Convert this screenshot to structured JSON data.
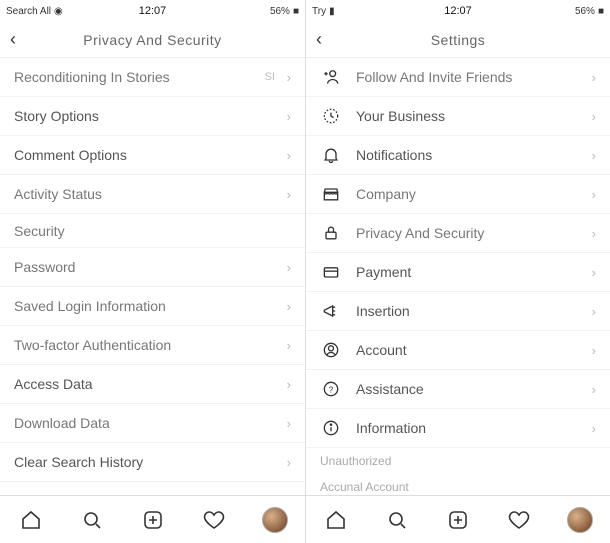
{
  "left": {
    "status": {
      "left": "Search All",
      "time": "12:07",
      "right": "56%"
    },
    "title": "Privacy And Security",
    "rows": [
      {
        "label": "Reconditioning In Stories",
        "mini": "SI",
        "chev": true,
        "strong": false
      },
      {
        "label": "Story Options",
        "chev": true,
        "strong": true
      },
      {
        "label": "Comment Options",
        "chev": true,
        "strong": true
      },
      {
        "label": "Activity Status",
        "chev": true
      },
      {
        "label": "Security",
        "section": true
      },
      {
        "label": "Password",
        "chev": true
      },
      {
        "label": "Saved Login Information",
        "chev": true
      },
      {
        "label": "Two-factor Authentication",
        "chev": true
      },
      {
        "label": "Access Data",
        "chev": true,
        "strong": true
      },
      {
        "label": "Download Data",
        "chev": true
      },
      {
        "label": "Clear Search History",
        "chev": true,
        "strong": true
      }
    ]
  },
  "right": {
    "status": {
      "left": "Try",
      "time": "12:07",
      "right": "56%"
    },
    "title": "Settings",
    "rows": [
      {
        "icon": "addperson",
        "label": "Follow And Invite Friends",
        "chev": true
      },
      {
        "icon": "clock",
        "label": "Your Business",
        "chev": true,
        "strong": true
      },
      {
        "icon": "bell",
        "label": "Notifications",
        "chev": true,
        "strong": true
      },
      {
        "icon": "store",
        "label": "Company",
        "chev": true
      },
      {
        "icon": "lock",
        "label": "Privacy And Security",
        "chev": true
      },
      {
        "icon": "card",
        "label": "Payment",
        "chev": true,
        "strong": true
      },
      {
        "icon": "mega",
        "label": "Insertion",
        "chev": true,
        "strong": true
      },
      {
        "icon": "user",
        "label": "Account",
        "chev": true,
        "strong": true
      },
      {
        "icon": "help",
        "label": "Assistance",
        "chev": true,
        "strong": true
      },
      {
        "icon": "info",
        "label": "Information",
        "chev": true,
        "strong": true
      }
    ],
    "sub1": "Unauthorized",
    "sub2": "Accunal Account"
  },
  "nav": [
    "home",
    "search",
    "add",
    "heart",
    "avatar"
  ]
}
